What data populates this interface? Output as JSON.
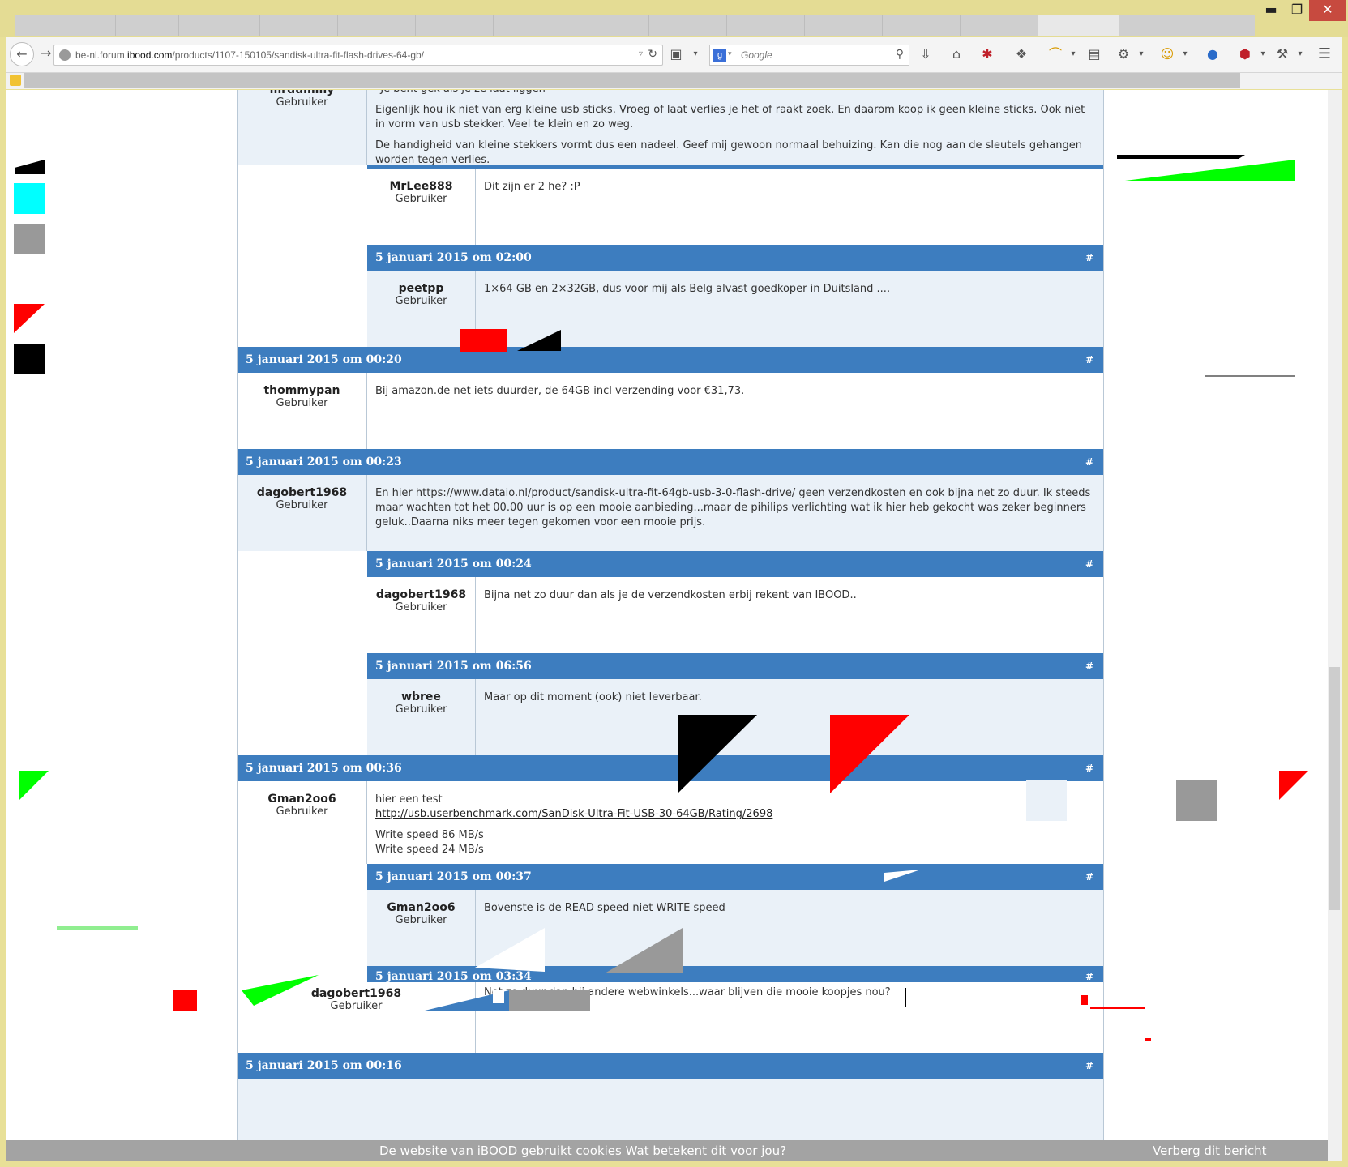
{
  "window": {
    "minimize": "▬",
    "maximize": "❐",
    "close": "✕"
  },
  "browser": {
    "url_prefix": "be-nl.forum.",
    "url_domain": "ibood.com",
    "url_path": "/products/1107-150105/sandisk-ultra-fit-flash-drives-64-gb/",
    "search_engine": "g",
    "search_placeholder": "Google"
  },
  "posts": [
    {
      "user": "mrdummy",
      "role": "Gebruiker",
      "paragraphs": [
        "“Je bent gek als je ze laat liggen”",
        "Eigenlijk hou ik niet van erg kleine usb sticks. Vroeg of laat verlies je het of raakt zoek. En daarom koop ik geen kleine sticks. Ook niet in vorm van usb stekker. Veel te klein en zo weg.",
        "De handigheid van kleine stekkers vormt dus een nadeel. Geef mij gewoon normaal behuizing. Kan die nog aan de sleutels gehangen worden tegen verlies."
      ]
    },
    {
      "user": "MrLee888",
      "role": "Gebruiker",
      "text": "Dit zijn er 2 he? :P"
    },
    {
      "date": "5 januari 2015 om 02:00",
      "hash": "#",
      "user": "peetpp",
      "role": "Gebruiker",
      "text": "1×64 GB en 2×32GB, dus voor mij als Belg alvast goedkoper in Duitsland ...."
    },
    {
      "date": "5 januari 2015 om 00:20",
      "hash": "#",
      "user": "thommypan",
      "role": "Gebruiker",
      "text": "Bij amazon.de net iets duurder, de 64GB incl verzending voor €31,73."
    },
    {
      "date": "5 januari 2015 om 00:23",
      "hash": "#",
      "user": "dagobert1968",
      "role": "Gebruiker",
      "text": "En hier https://www.dataio.nl/product/sandisk-ultra-fit-64gb-usb-3-0-flash-drive/    geen verzendkosten en ook bijna net zo duur. Ik steeds maar wachten tot het 00.00 uur is op een mooie aanbieding...maar de pihilips verlichting wat ik hier heb gekocht was zeker beginners geluk..Daarna niks meer tegen gekomen voor een mooie prijs."
    },
    {
      "date": "5 januari 2015 om 00:24",
      "hash": "#",
      "user": "dagobert1968",
      "role": "Gebruiker",
      "text": "Bijna net zo duur dan als je de verzendkosten erbij rekent van IBOOD.."
    },
    {
      "date": "5 januari 2015 om 06:56",
      "hash": "#",
      "user": "wbree",
      "role": "Gebruiker",
      "text": "Maar op dit moment (ook) niet leverbaar."
    },
    {
      "date": "5 januari 2015 om 00:36",
      "hash": "#",
      "user": "Gman2oo6",
      "role": "Gebruiker",
      "line1": "hier een test",
      "link": "http://usb.userbenchmark.com/SanDisk-Ultra-Fit-USB-30-64GB/Rating/2698",
      "line2": "Write speed 86 MB/s",
      "line3": "Write speed 24 MB/s"
    },
    {
      "date": "5 januari 2015 om 00:37",
      "hash": "#",
      "user": "Gman2oo6",
      "role": "Gebruiker",
      "text": "Bovenste is de READ speed niet WRITE speed"
    },
    {
      "date": "5 januari 2015 om 03:34",
      "hash": "#",
      "user": "dagobert1968",
      "role": "Gebruiker",
      "text": "Net zo duur dan bij andere webwinkels...waar blijven die mooie koopjes nou?"
    },
    {
      "date": "5 januari 2015 om 00:16",
      "hash": "#"
    }
  ],
  "cookie_bar": {
    "text": "De website van iBOOD gebruikt cookies ",
    "link": "Wat betekent dit voor jou?",
    "hide": "Verberg dit bericht"
  },
  "colors": {
    "header_blue": "#3d7dbf",
    "alt_row": "#eaf1f8",
    "cookie_bar": "#a3a3a3",
    "window_frame": "#e4dc94"
  }
}
